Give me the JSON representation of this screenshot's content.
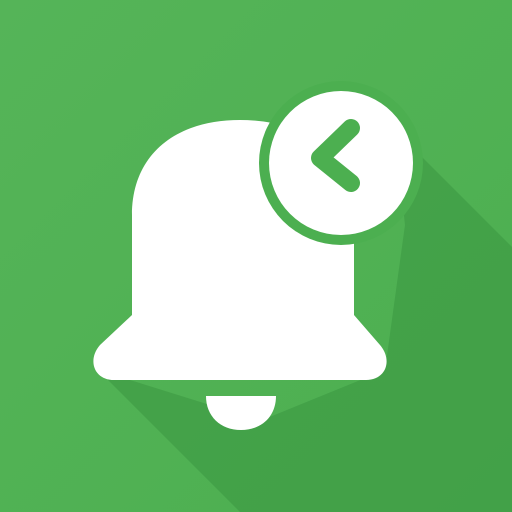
{
  "app_icon": {
    "name": "notification-history-icon",
    "background_color": "#4caf50",
    "background_highlight_color": "#55b458",
    "long_shadow_color": "#3e9943",
    "foreground_color": "#ffffff",
    "glyph_color": "#4caf50",
    "bell_icon": "bell-icon",
    "badge_icon": "back-chevron-icon"
  }
}
